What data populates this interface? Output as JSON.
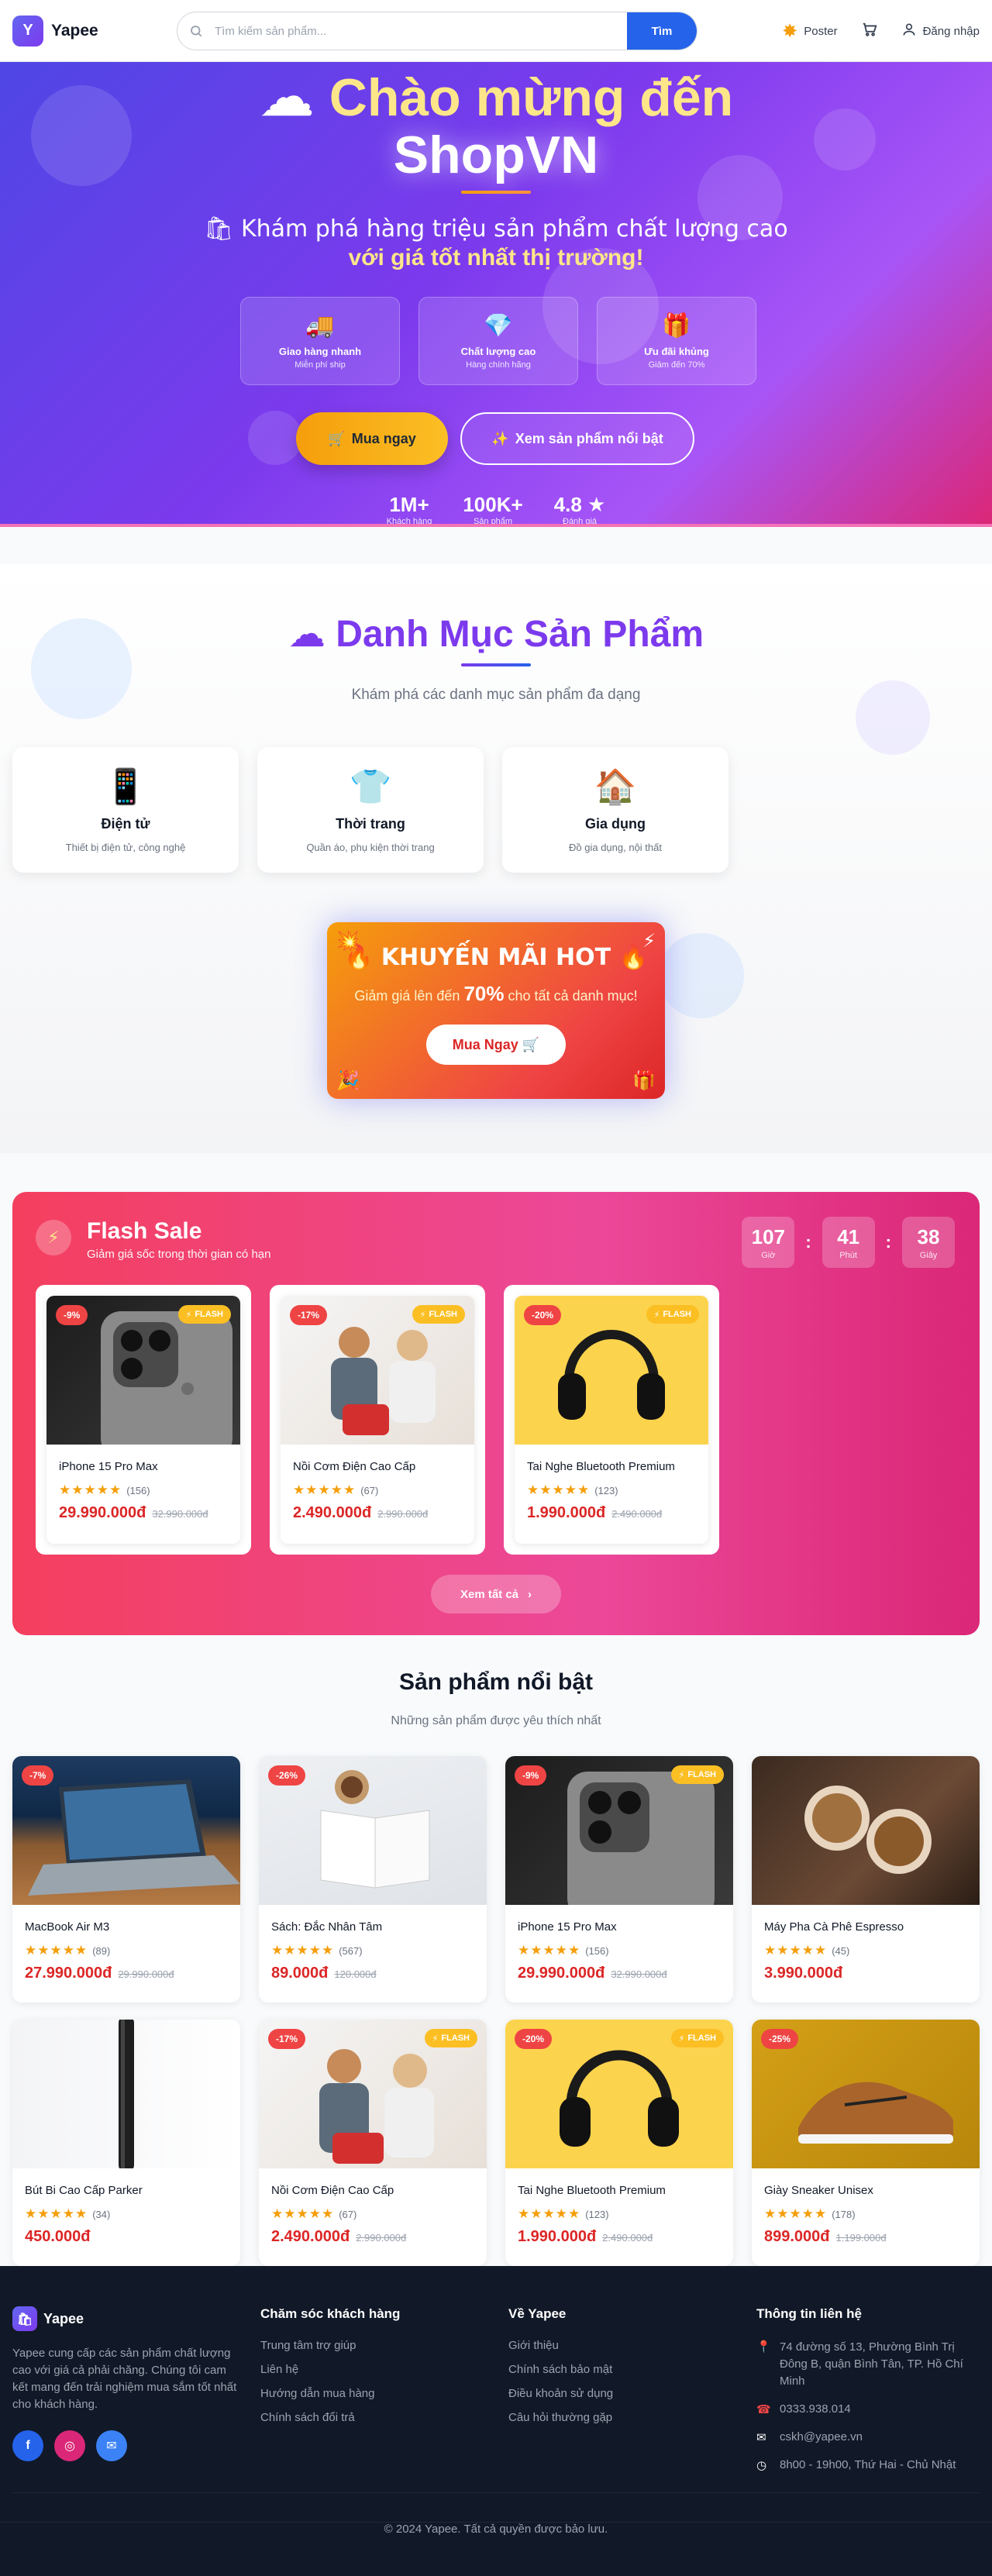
{
  "header": {
    "logo_letter": "Y",
    "logo_text": "Yapee",
    "search_placeholder": "Tìm kiếm sản phẩm...",
    "search_button": "Tìm",
    "nav": [
      {
        "label": "Poster",
        "icon": "burst-icon"
      },
      {
        "label": "",
        "icon": "cart-icon"
      },
      {
        "label": "Đăng nhập",
        "icon": "user-icon"
      }
    ]
  },
  "hero": {
    "title_line1": "Chào mừng đến",
    "title_line2": "ShopVN",
    "subtitle_line1": "🛍 Khám phá hàng triệu sản phẩm chất lượng cao",
    "subtitle_line2": "với giá tốt nhất thị trường!",
    "features": [
      {
        "icon": "🚚",
        "title": "Giao hàng nhanh",
        "sub": "Miễn phí ship"
      },
      {
        "icon": "💎",
        "title": "Chất lượng cao",
        "sub": "Hàng chính hãng"
      },
      {
        "icon": "🎁",
        "title": "Ưu đãi khủng",
        "sub": "Giảm đến 70%"
      }
    ],
    "buy_button": "Mua ngay",
    "featured_button": "Xem sản phẩm nổi bật",
    "stats": [
      {
        "value": "1M+",
        "label": "Khách hàng"
      },
      {
        "value": "100K+",
        "label": "Sản phẩm"
      },
      {
        "value": "4.8 ★",
        "label": "Đánh giá"
      }
    ]
  },
  "categories": {
    "title": "Danh Mục Sản Phẩm",
    "subtitle": "Khám phá các danh mục sản phẩm đa dạng",
    "items": [
      {
        "icon": "📱",
        "name": "Điện tử",
        "desc": "Thiết bị điện tử, công nghệ"
      },
      {
        "icon": "👕",
        "name": "Thời trang",
        "desc": "Quần áo, phụ kiện thời trang"
      },
      {
        "icon": "🏠",
        "name": "Gia dụng",
        "desc": "Đồ gia dụng, nội thất"
      }
    ]
  },
  "promo": {
    "title": "🔥 KHUYẾN MÃI HOT 🔥",
    "text_before": "Giảm giá lên đến",
    "percent": "70%",
    "text_after": "cho tất cả danh mục!",
    "button": "Mua Ngay 🛒"
  },
  "flash_sale": {
    "title": "Flash Sale",
    "subtitle": "Giảm giá sốc trong thời gian có hạn",
    "countdown": [
      {
        "value": "107",
        "label": "Giờ"
      },
      {
        "value": "41",
        "label": "Phút"
      },
      {
        "value": "38",
        "label": "Giây"
      }
    ],
    "tag_label": "FLASH",
    "products": [
      {
        "name": "iPhone 15 Pro Max",
        "discount": "-9%",
        "reviews": "(156)",
        "price": "29.990.000đ",
        "old_price": "32.990.000đ",
        "rating": 5
      },
      {
        "name": "Nồi Cơm Điện Cao Cấp",
        "discount": "-17%",
        "reviews": "(67)",
        "price": "2.490.000đ",
        "old_price": "2.990.000đ",
        "rating": 5
      },
      {
        "name": "Tai Nghe Bluetooth Premium",
        "discount": "-20%",
        "reviews": "(123)",
        "price": "1.990.000đ",
        "old_price": "2.490.000đ",
        "rating": 5
      }
    ],
    "see_all": "Xem tất cả"
  },
  "featured": {
    "title": "Sản phẩm nổi bật",
    "subtitle": "Những sản phẩm được yêu thích nhất",
    "tag_label": "FLASH",
    "products": [
      {
        "name": "MacBook Air M3",
        "discount": "-7%",
        "flash": false,
        "reviews": "(89)",
        "price": "27.990.000đ",
        "old_price": "29.990.000đ",
        "rating": 5
      },
      {
        "name": "Sách: Đắc Nhân Tâm",
        "discount": "-26%",
        "flash": false,
        "reviews": "(567)",
        "price": "89.000đ",
        "old_price": "120.000đ",
        "rating": 5
      },
      {
        "name": "iPhone 15 Pro Max",
        "discount": "-9%",
        "flash": true,
        "reviews": "(156)",
        "price": "29.990.000đ",
        "old_price": "32.990.000đ",
        "rating": 5
      },
      {
        "name": "Máy Pha Cà Phê Espresso",
        "discount": "",
        "flash": false,
        "reviews": "(45)",
        "price": "3.990.000đ",
        "old_price": "",
        "rating": 5
      },
      {
        "name": "Bút Bi Cao Cấp Parker",
        "discount": "",
        "flash": false,
        "reviews": "(34)",
        "price": "450.000đ",
        "old_price": "",
        "rating": 5
      },
      {
        "name": "Nồi Cơm Điện Cao Cấp",
        "discount": "-17%",
        "flash": true,
        "reviews": "(67)",
        "price": "2.490.000đ",
        "old_price": "2.990.000đ",
        "rating": 5
      },
      {
        "name": "Tai Nghe Bluetooth Premium",
        "discount": "-20%",
        "flash": true,
        "reviews": "(123)",
        "price": "1.990.000đ",
        "old_price": "2.490.000đ",
        "rating": 5
      },
      {
        "name": "Giày Sneaker Unisex",
        "discount": "-25%",
        "flash": false,
        "reviews": "(178)",
        "price": "899.000đ",
        "old_price": "1.199.000đ",
        "rating": 5
      }
    ]
  },
  "footer": {
    "logo_text": "Yapee",
    "description": "Yapee cung cấp các sản phẩm chất lượng cao với giá cả phải chăng. Chúng tôi cam kết mang đến trải nghiệm mua sắm tốt nhất cho khách hàng.",
    "customer_care": {
      "title": "Chăm sóc khách hàng",
      "links": [
        "Trung tâm trợ giúp",
        "Liên hệ",
        "Hướng dẫn mua hàng",
        "Chính sách đổi trả"
      ]
    },
    "about": {
      "title": "Về Yapee",
      "links": [
        "Giới thiệu",
        "Chính sách bảo mật",
        "Điều khoản sử dụng",
        "Câu hỏi thường gặp"
      ]
    },
    "contact": {
      "title": "Thông tin liên hệ",
      "address": "74 đường số 13, Phường Bình Trị Đông B, quận Bình Tân, TP. Hồ Chí Minh",
      "phone": "0333.938.014",
      "email": "cskh@yapee.vn",
      "hours": "8h00 - 19h00, Thứ Hai - Chủ Nhật"
    },
    "copyright": "© 2024 Yapee. Tất cả quyền được bảo lưu."
  }
}
